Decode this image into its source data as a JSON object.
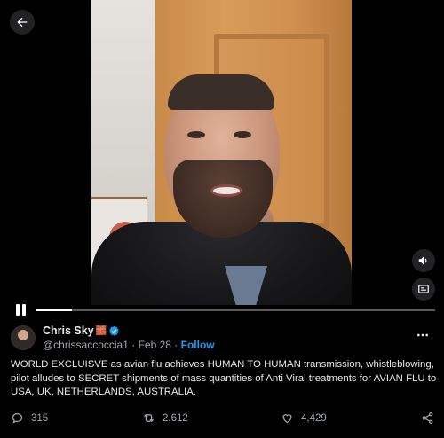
{
  "icons": {
    "back": "arrow-left-icon",
    "volume": "volume-icon",
    "settings": "video-settings-icon",
    "pause": "pause-icon",
    "verified": "verified-badge-icon",
    "more": "more-options-icon",
    "reply": "reply-icon",
    "repost": "repost-icon",
    "like": "heart-icon",
    "share": "share-icon"
  },
  "video": {
    "progress": 0.09
  },
  "post": {
    "author_name": "Chris Sky",
    "author_emoji": "🧱",
    "handle": "@chrissaccoccia1",
    "separator": "·",
    "date": "Feb 28",
    "follow_label": "Follow",
    "text": "WORLD EXCLUISVE as avian flu achieves HUMAN TO HUMAN transmission, whistleblowing, pilot alludes to SECRET shipments of mass quantities of Anti Viral treatments for AVIAN FLU to USA, UK, NETHERLANDS, AUSTRALIA."
  },
  "stats": {
    "replies": "315",
    "reposts": "2,612",
    "likes": "4,429"
  },
  "colors": {
    "accent": "#1d9bf0",
    "background": "#000000",
    "text": "#e7e9ea",
    "muted": "#a4a9ad"
  }
}
